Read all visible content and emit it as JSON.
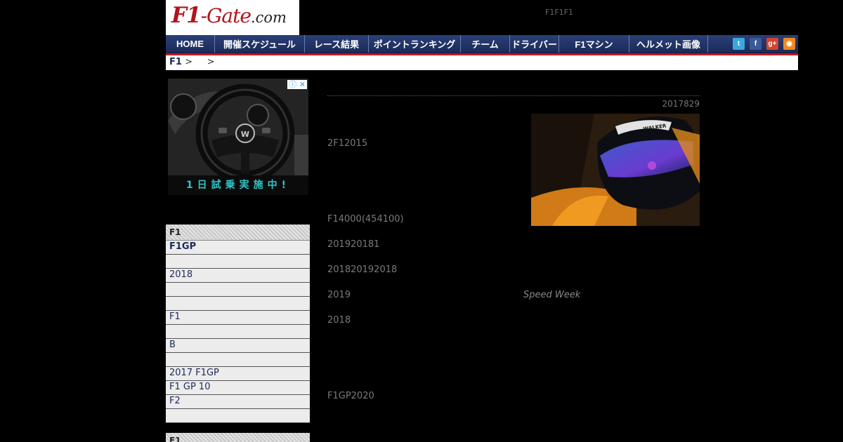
{
  "header": {
    "logo": {
      "f1": "F1",
      "gate": "-Gate",
      "com": ".com"
    },
    "tagline": "F1F1F1"
  },
  "nav": {
    "items": [
      "HOME",
      "開催スケジュール",
      "レース結果",
      "ポイントランキング",
      "チーム",
      "ドライバー",
      "F1マシン",
      "ヘルメット画像"
    ],
    "social": [
      "twitter-icon",
      "facebook-icon",
      "google-plus-icon",
      "rss-icon"
    ]
  },
  "breadcrumb": {
    "home": "F1",
    "sep1": " >",
    "sep2": ">"
  },
  "ad": {
    "caption": "1日試乗実施中!",
    "close": "ⓘ ✕"
  },
  "sidebar": {
    "title": "F1",
    "items": [
      "F1GP",
      "",
      "2018",
      "",
      "",
      "F1",
      "",
      " B",
      "",
      "2017 F1GP",
      "F1 GP 10",
      "F2",
      ""
    ],
    "second_title": "F1"
  },
  "article": {
    "date": "2017829",
    "p1": "2F12015",
    "p2": "F14000(454100)",
    "p3": "201920181",
    "p4": "201820192018",
    "p5": "2019",
    "ref": "Speed Week",
    "p6": "2018",
    "p7": "F1GP2020"
  },
  "colors": {
    "nav": "#1f2f63",
    "accent_red": "#c21a22",
    "sidebar_text": "#1b2a58"
  }
}
